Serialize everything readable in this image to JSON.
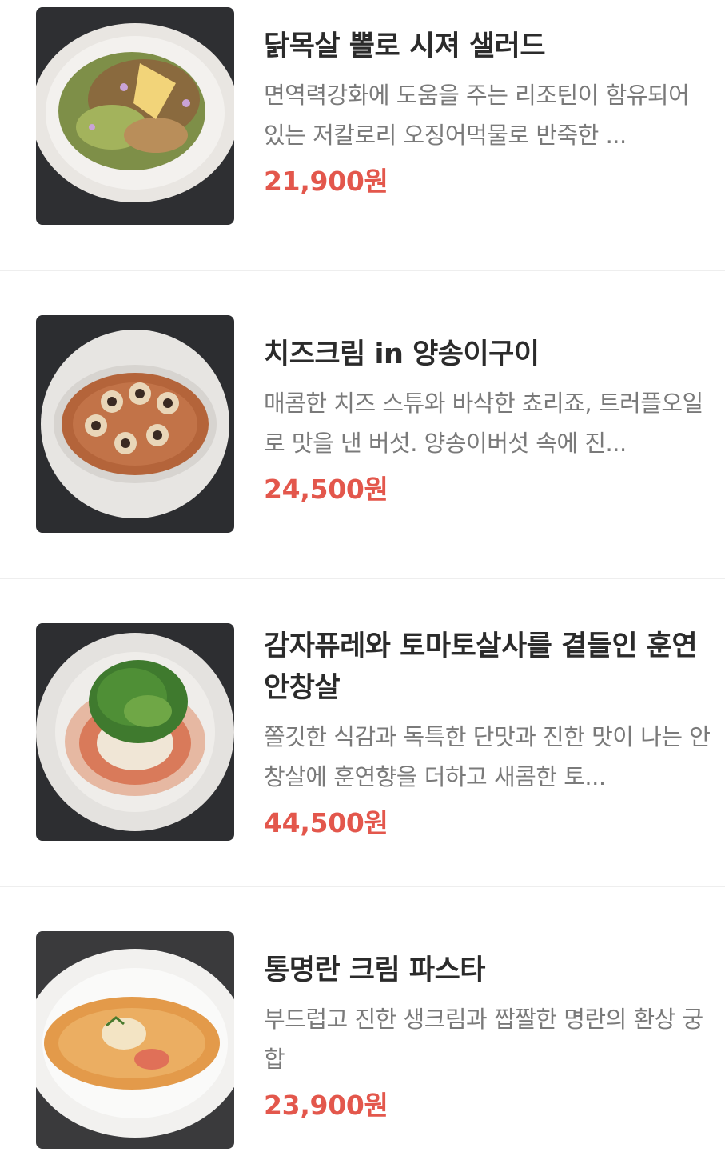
{
  "colors": {
    "title": "#2b2b2b",
    "description": "#7a7a7a",
    "price": "#e3574c",
    "divider": "#eeeeee"
  },
  "menu": {
    "items": [
      {
        "name": "닭목살 뽈로 시져 샐러드",
        "description": "면역력강화에 도움을 주는 리조틴이 함유되어 있는 저칼로리 오징어먹물로 반죽한 ...",
        "price": "21,900원",
        "image": "caesar-salad-photo"
      },
      {
        "name": "치즈크림 in 양송이구이",
        "description": "매콤한 치즈 스튜와 바삭한 쵸리죠, 트러플오일로 맛을 낸 버섯. 양송이버섯 속에 진...",
        "price": "24,500원",
        "image": "mushroom-cheese-photo"
      },
      {
        "name": "감자퓨레와 토마토살사를 곁들인 훈연 안창살",
        "description": "쫄깃한 식감과 독특한 단맛과 진한 맛이 나는 안창살에 훈연향을 더하고 새콤한 토...",
        "price": "44,500원",
        "image": "smoked-beef-salad-photo"
      },
      {
        "name": "통명란 크림 파스타",
        "description": "부드럽고 진한 생크림과 짭짤한 명란의 환상 궁합",
        "price": "23,900원",
        "image": "pollock-roe-pasta-photo"
      }
    ]
  }
}
